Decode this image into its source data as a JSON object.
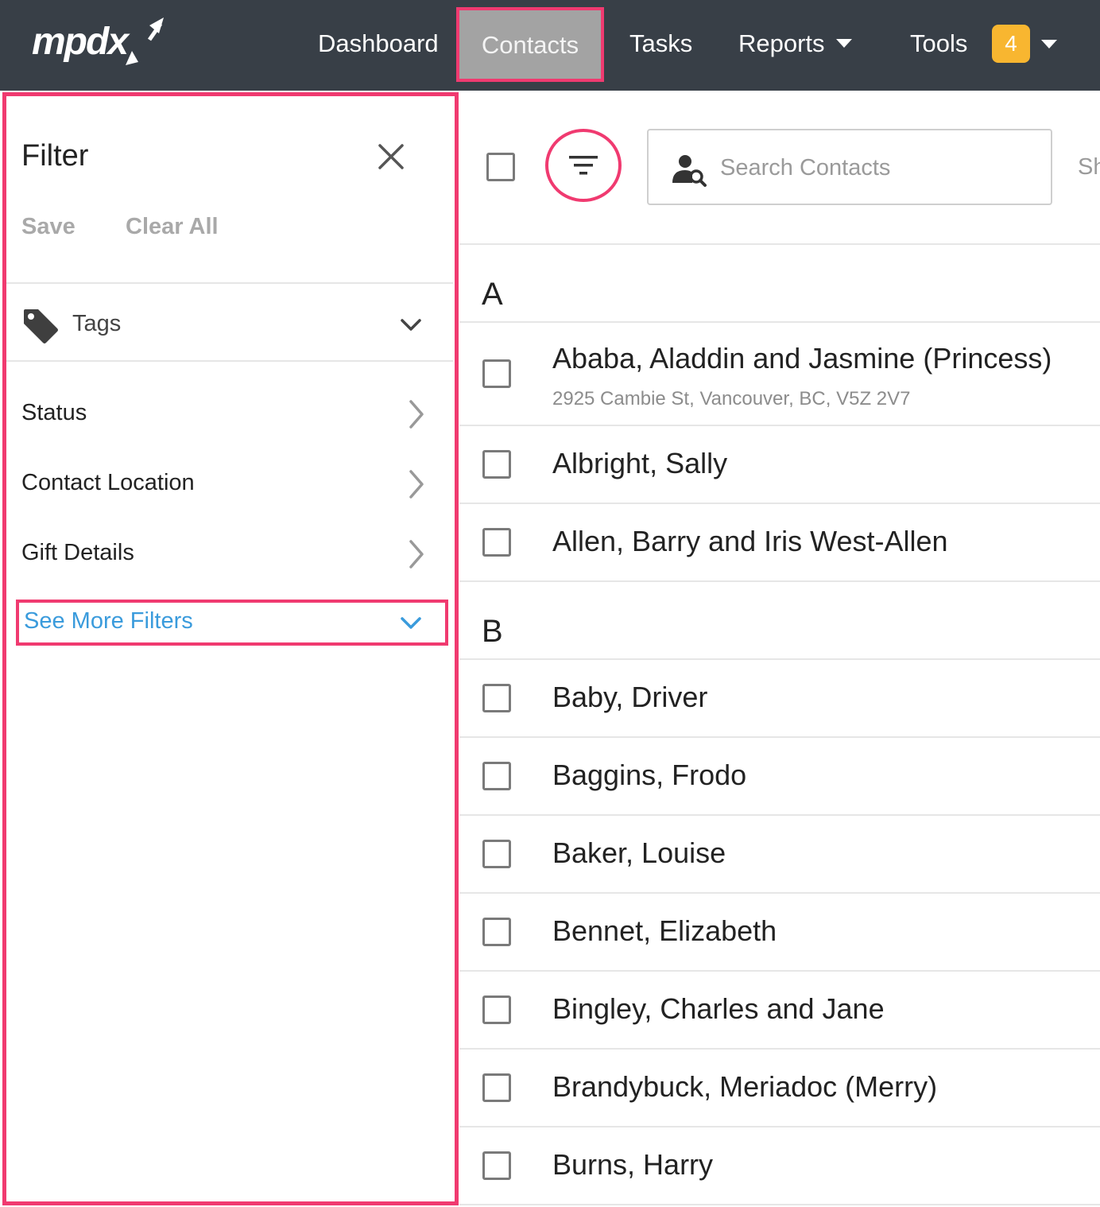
{
  "app": {
    "logo_text": "mpdx"
  },
  "nav": {
    "dashboard": "Dashboard",
    "contacts": "Contacts",
    "tasks": "Tasks",
    "reports": "Reports",
    "tools": "Tools",
    "tools_badge": "4"
  },
  "filter": {
    "title": "Filter",
    "save": "Save",
    "clear_all": "Clear All",
    "tags": "Tags",
    "items": [
      {
        "label": "Status"
      },
      {
        "label": "Contact Location"
      },
      {
        "label": "Gift Details"
      }
    ],
    "see_more": "See More Filters"
  },
  "search": {
    "placeholder": "Search Contacts",
    "value": ""
  },
  "toolbar": {
    "overflow_text": "Sh"
  },
  "groups": [
    {
      "letter": "A",
      "contacts": [
        {
          "name": "Ababa, Aladdin and Jasmine (Princess)",
          "address": "2925 Cambie St, Vancouver, BC, V5Z 2V7"
        },
        {
          "name": "Albright, Sally"
        },
        {
          "name": "Allen, Barry and Iris West-Allen"
        }
      ]
    },
    {
      "letter": "B",
      "contacts": [
        {
          "name": "Baby, Driver"
        },
        {
          "name": "Baggins, Frodo"
        },
        {
          "name": "Baker, Louise"
        },
        {
          "name": "Bennet, Elizabeth"
        },
        {
          "name": "Bingley, Charles and Jane"
        },
        {
          "name": "Brandybuck, Meriadoc (Merry)"
        },
        {
          "name": "Burns, Harry"
        }
      ]
    }
  ],
  "colors": {
    "nav_bg": "#383f47",
    "highlight": "#f03a70",
    "badge": "#f8b630",
    "link": "#3a9bdc"
  },
  "icons": {
    "close": "close-icon",
    "tag": "tag-icon",
    "chevron_down": "chevron-down-icon",
    "chevron_right": "chevron-right-icon",
    "filter": "filter-icon",
    "search": "search-icon"
  }
}
